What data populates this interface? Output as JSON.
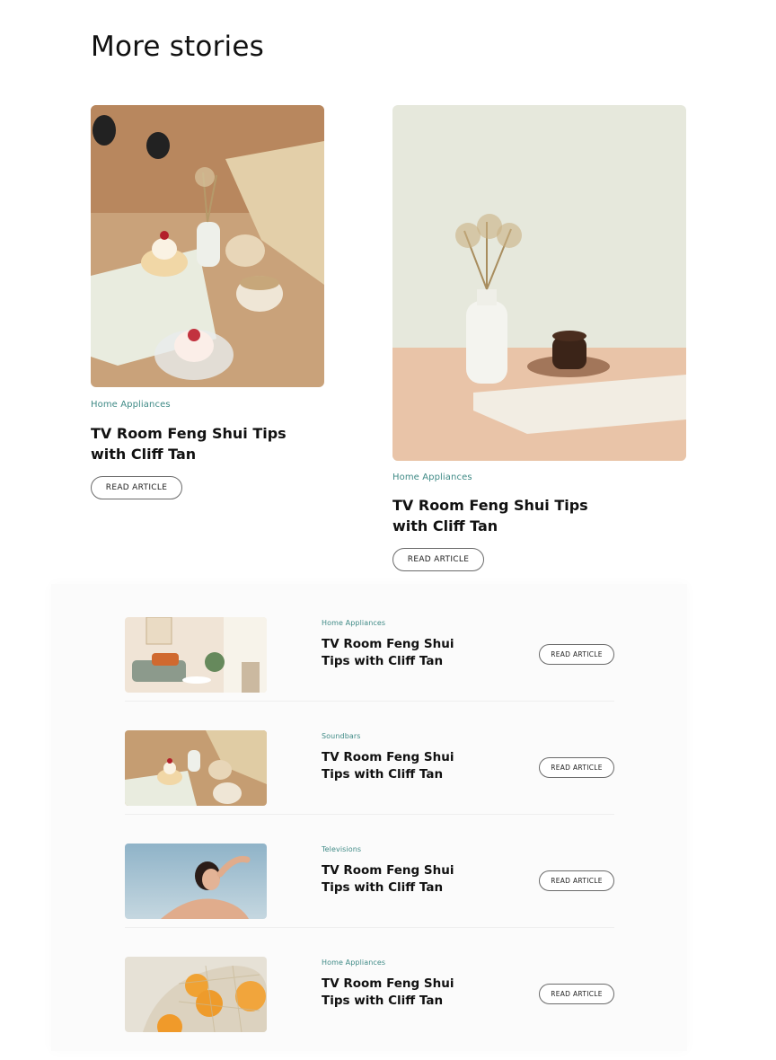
{
  "section": {
    "title": "More stories"
  },
  "featured": [
    {
      "category": "Home Appliances",
      "title": "TV Room Feng Shui Tips with Cliff Tan",
      "button": "READ ARTICLE",
      "image": "desserts-table-photo"
    },
    {
      "category": "Home Appliances",
      "title": "TV Room Feng Shui Tips with Cliff Tan",
      "button": "READ ARTICLE",
      "image": "vase-and-cake-photo"
    }
  ],
  "list": [
    {
      "category": "Home Appliances",
      "title": "TV Room Feng Shui Tips with Cliff Tan",
      "button": "READ ARTICLE",
      "image": "living-room-photo"
    },
    {
      "category": "Soundbars",
      "title": "TV Room Feng Shui Tips with Cliff Tan",
      "button": "READ ARTICLE",
      "image": "desserts-table-photo"
    },
    {
      "category": "Televisions",
      "title": "TV Room Feng Shui Tips with Cliff Tan",
      "button": "READ ARTICLE",
      "image": "woman-sky-photo"
    },
    {
      "category": "Home Appliances",
      "title": "TV Room Feng Shui Tips with Cliff Tan",
      "button": "READ ARTICLE",
      "image": "oranges-photo"
    }
  ],
  "colors": {
    "category": "#3f8a86",
    "text": "#111111",
    "panel": "#fbfbfb"
  }
}
